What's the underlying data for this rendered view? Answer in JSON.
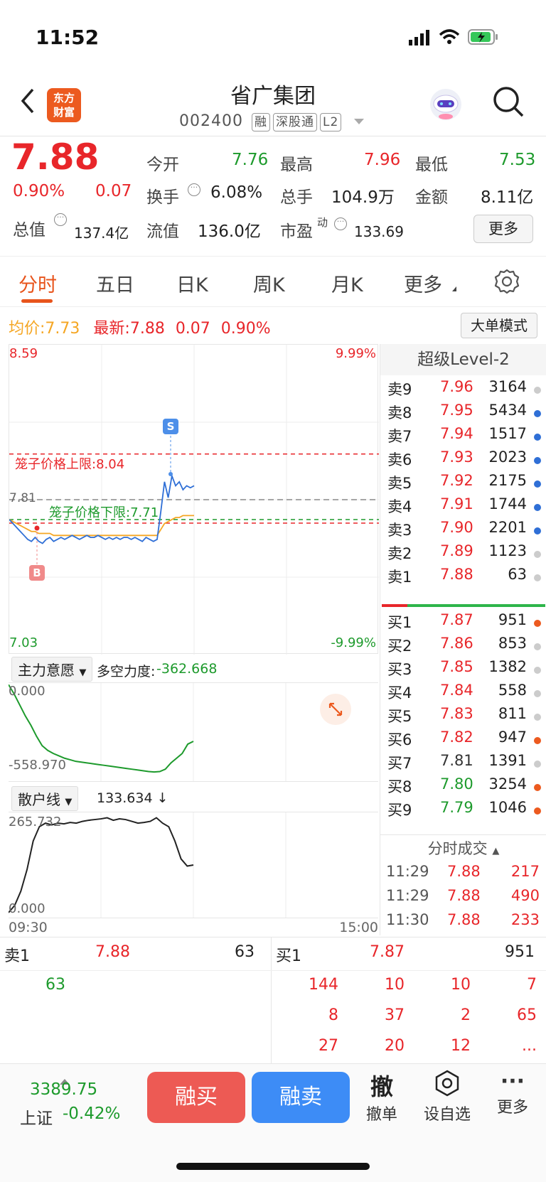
{
  "status": {
    "time": "11:52"
  },
  "header": {
    "logo_line1": "东方",
    "logo_line2": "财富",
    "title": "省广集团",
    "code": "002400",
    "tags": [
      "融",
      "深股通",
      "L2"
    ]
  },
  "quote": {
    "price": "7.88",
    "pct": "0.90%",
    "chg": "0.07",
    "open_label": "今开",
    "open": "7.76",
    "high_label": "最高",
    "high": "7.96",
    "low_label": "最低",
    "low": "7.53",
    "turnover_label": "换手",
    "turnover": "6.08%",
    "vol_label": "总手",
    "vol": "104.9万",
    "amount_label": "金额",
    "amount": "8.11亿",
    "mcap_label": "总值",
    "mcap": "137.4亿",
    "float_label": "流值",
    "float": "136.0亿",
    "pe_label": "市盈",
    "pe_sup": "动",
    "pe": "133.69",
    "more": "更多"
  },
  "tabs": [
    "分时",
    "五日",
    "日K",
    "周K",
    "月K",
    "更多"
  ],
  "infobar": {
    "avg_label": "均价:",
    "avg": "7.73",
    "last_label": "最新:",
    "last": "7.88",
    "chg": "0.07",
    "pct": "0.90%",
    "mode_btn": "大单模式"
  },
  "chart_data": [
    {
      "type": "line",
      "title": "",
      "y_top": "8.59",
      "y_bottom": "7.03",
      "pct_top": "9.99%",
      "pct_bottom": "-9.99%",
      "ref_price": "7.81",
      "x_start": "09:30",
      "x_end": "15:00",
      "upper_cage_label": "笼子价格上限:8.04",
      "lower_cage_label": "笼子价格下限:7.71",
      "upper_cage": 8.04,
      "lower_cage": 7.71,
      "markers": [
        "S",
        "B"
      ],
      "series": [
        {
          "name": "最新",
          "values": [
            7.71,
            7.69,
            7.67,
            7.65,
            7.63,
            7.61,
            7.6,
            7.62,
            7.6,
            7.59,
            7.61,
            7.62,
            7.6,
            7.61,
            7.62,
            7.61,
            7.62,
            7.63,
            7.62,
            7.61,
            7.62,
            7.63,
            7.62,
            7.62,
            7.63,
            7.62,
            7.61,
            7.62,
            7.61,
            7.62,
            7.61,
            7.62,
            7.62,
            7.61,
            7.62,
            7.61,
            7.6,
            7.62,
            7.61,
            7.6,
            7.61,
            7.75,
            7.9,
            7.82,
            7.93,
            7.88,
            7.9,
            7.86,
            7.88,
            7.87,
            7.88
          ]
        },
        {
          "name": "均价",
          "values": [
            7.71,
            7.7,
            7.69,
            7.68,
            7.67,
            7.66,
            7.65,
            7.65,
            7.64,
            7.64,
            7.64,
            7.64,
            7.63,
            7.63,
            7.63,
            7.63,
            7.63,
            7.63,
            7.63,
            7.63,
            7.63,
            7.63,
            7.63,
            7.63,
            7.63,
            7.63,
            7.63,
            7.63,
            7.63,
            7.63,
            7.63,
            7.63,
            7.63,
            7.63,
            7.63,
            7.63,
            7.63,
            7.63,
            7.63,
            7.63,
            7.63,
            7.66,
            7.69,
            7.7,
            7.71,
            7.72,
            7.72,
            7.73,
            7.73,
            7.73,
            7.73
          ]
        }
      ]
    },
    {
      "type": "line",
      "select": "主力意愿",
      "label": "多空力度:",
      "value": "-362.668",
      "y_top": "0.000",
      "y_bottom": "-558.970",
      "series": [
        {
          "name": "主力意愿",
          "values": [
            0,
            -60,
            -130,
            -200,
            -260,
            -330,
            -390,
            -420,
            -440,
            -455,
            -470,
            -480,
            -490,
            -495,
            -500,
            -505,
            -510,
            -515,
            -520,
            -525,
            -530,
            -535,
            -540,
            -545,
            -550,
            -555,
            -558,
            -555,
            -540,
            -500,
            -470,
            -440,
            -380,
            -362
          ]
        }
      ]
    },
    {
      "type": "line",
      "select": "散户线",
      "label": "",
      "value": "133.634 ↓",
      "y_top": "265.732",
      "y_bottom": "0.000",
      "series": [
        {
          "name": "散户线",
          "values": [
            0,
            20,
            60,
            120,
            200,
            240,
            250,
            245,
            250,
            248,
            252,
            250,
            255,
            258,
            260,
            262,
            265,
            258,
            262,
            260,
            255,
            250,
            252,
            255,
            265,
            250,
            240,
            200,
            150,
            130,
            133
          ]
        }
      ]
    }
  ],
  "orderbook": {
    "title": "超级Level-2",
    "asks": [
      {
        "n": "卖9",
        "p": "7.96",
        "v": "3164",
        "dot": "#ccc"
      },
      {
        "n": "卖8",
        "p": "7.95",
        "v": "5434",
        "dot": "#2f6fd6"
      },
      {
        "n": "卖7",
        "p": "7.94",
        "v": "1517",
        "dot": "#2f6fd6"
      },
      {
        "n": "卖6",
        "p": "7.93",
        "v": "2023",
        "dot": "#2f6fd6"
      },
      {
        "n": "卖5",
        "p": "7.92",
        "v": "2175",
        "dot": "#2f6fd6"
      },
      {
        "n": "卖4",
        "p": "7.91",
        "v": "1744",
        "dot": "#2f6fd6"
      },
      {
        "n": "卖3",
        "p": "7.90",
        "v": "2201",
        "dot": "#2f6fd6"
      },
      {
        "n": "卖2",
        "p": "7.89",
        "v": "1123",
        "dot": "#ccc"
      },
      {
        "n": "卖1",
        "p": "7.88",
        "v": "63",
        "dot": "#ccc"
      }
    ],
    "bids": [
      {
        "n": "买1",
        "p": "7.87",
        "v": "951",
        "dot": "#ec5a1f",
        "pc": "red"
      },
      {
        "n": "买2",
        "p": "7.86",
        "v": "853",
        "dot": "#ccc",
        "pc": "red"
      },
      {
        "n": "买3",
        "p": "7.85",
        "v": "1382",
        "dot": "#ccc",
        "pc": "red"
      },
      {
        "n": "买4",
        "p": "7.84",
        "v": "558",
        "dot": "#ccc",
        "pc": "red"
      },
      {
        "n": "买5",
        "p": "7.83",
        "v": "811",
        "dot": "#ccc",
        "pc": "red"
      },
      {
        "n": "买6",
        "p": "7.82",
        "v": "947",
        "dot": "#ec5a1f",
        "pc": "red"
      },
      {
        "n": "买7",
        "p": "7.81",
        "v": "1391",
        "dot": "#ccc",
        "pc": "dark"
      },
      {
        "n": "买8",
        "p": "7.80",
        "v": "3254",
        "dot": "#ec5a1f",
        "pc": "green"
      },
      {
        "n": "买9",
        "p": "7.79",
        "v": "1046",
        "dot": "#ec5a1f",
        "pc": "green"
      }
    ],
    "trades_title": "分时成交",
    "trades": [
      {
        "t": "11:29",
        "p": "7.88",
        "v": "217"
      },
      {
        "t": "11:29",
        "p": "7.88",
        "v": "490"
      },
      {
        "t": "11:30",
        "p": "7.88",
        "v": "233"
      }
    ]
  },
  "queue": {
    "ask_label": "卖1",
    "ask_price": "7.88",
    "ask_vol": "63",
    "bid_label": "买1",
    "bid_price": "7.87",
    "bid_vol": "951",
    "ask_orders": [
      "63"
    ],
    "bid_orders": [
      "144",
      "10",
      "10",
      "7",
      "8",
      "37",
      "2",
      "65",
      "27",
      "20",
      "12",
      "..."
    ]
  },
  "toolbar": {
    "index_value": "3389.75",
    "index_name": "上证",
    "index_pct": "-0.42%",
    "buy": "融买",
    "sell": "融卖",
    "cancel_icon": "撤",
    "cancel": "撤单",
    "watch": "设自选",
    "more": "更多"
  }
}
